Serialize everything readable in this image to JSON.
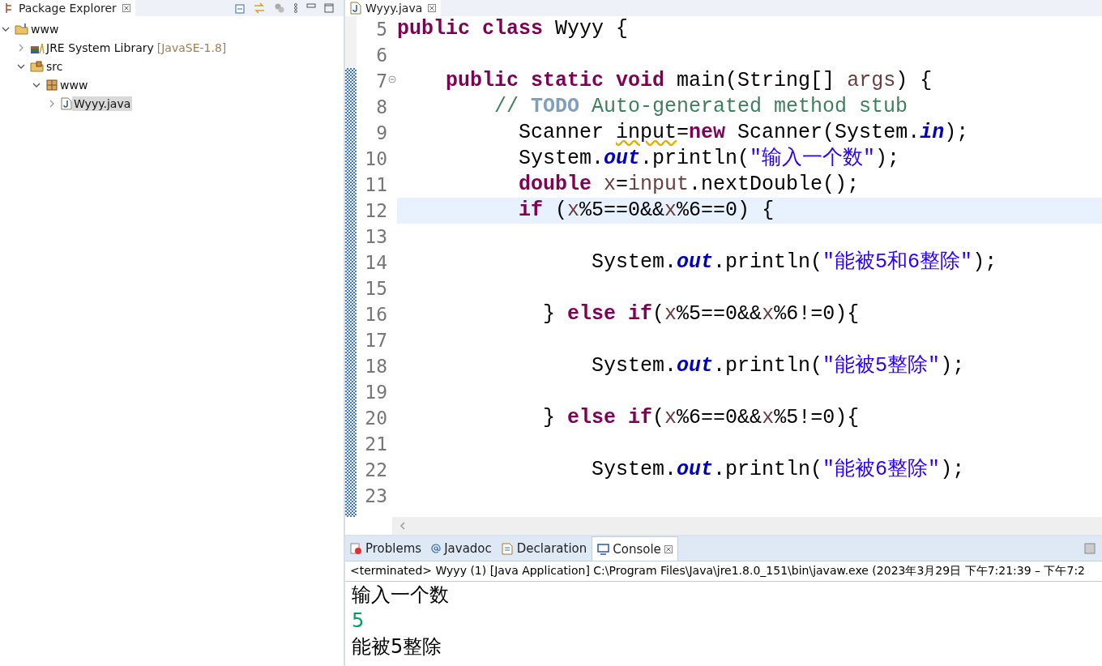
{
  "explorer": {
    "title": "Package Explorer",
    "tree": [
      {
        "label": "www",
        "kind": "project",
        "expanded": true,
        "selected": false,
        "children": [
          {
            "label": "JRE System Library",
            "decoration": "[JavaSE-1.8]",
            "kind": "library",
            "expanded": false,
            "selected": false
          },
          {
            "label": "src",
            "kind": "source-folder",
            "expanded": true,
            "selected": false,
            "children": [
              {
                "label": "www",
                "kind": "package",
                "expanded": true,
                "selected": false,
                "children": [
                  {
                    "label": "Wyyy.java",
                    "kind": "java-file",
                    "expanded": false,
                    "selected": true
                  }
                ]
              }
            ]
          }
        ]
      }
    ]
  },
  "editor": {
    "tab": "Wyyy.java",
    "lines": [
      {
        "number": "5",
        "current": false,
        "tokens": [
          {
            "kind": "keyword",
            "text": "public "
          },
          {
            "kind": "keyword",
            "text": "class"
          },
          {
            "kind": "plain",
            "text": " Wyyy {"
          }
        ]
      },
      {
        "number": "6",
        "current": false
      },
      {
        "number": "7",
        "current": false,
        "tokens": [
          {
            "kind": "keyword",
            "text": "    public "
          },
          {
            "kind": "keyword",
            "text": "static "
          },
          {
            "kind": "keyword",
            "text": "void"
          },
          {
            "kind": "plain",
            "text": " main(String[] "
          },
          {
            "kind": "local",
            "text": "args"
          },
          {
            "kind": "plain",
            "text": ") {"
          }
        ]
      },
      {
        "number": "8",
        "current": false,
        "tokens": [
          {
            "kind": "comment",
            "text": "        // "
          },
          {
            "kind": "todo",
            "text": "TODO"
          },
          {
            "kind": "comment",
            "text": " Auto-generated method stub"
          }
        ]
      },
      {
        "number": "9",
        "current": false,
        "tokens": [
          {
            "kind": "plain",
            "text": "          Scanner "
          },
          {
            "kind": "warning",
            "text": "input"
          },
          {
            "kind": "plain",
            "text": "="
          },
          {
            "kind": "keyword",
            "text": "new"
          },
          {
            "kind": "plain",
            "text": " Scanner(System."
          },
          {
            "kind": "field",
            "text": "in"
          },
          {
            "kind": "plain",
            "text": ");"
          }
        ]
      },
      {
        "number": "10",
        "current": false,
        "tokens": [
          {
            "kind": "plain",
            "text": "          System."
          },
          {
            "kind": "field",
            "text": "out"
          },
          {
            "kind": "plain",
            "text": ".println("
          },
          {
            "kind": "string",
            "text": "\"输入一个数\""
          },
          {
            "kind": "plain",
            "text": ");"
          }
        ]
      },
      {
        "number": "11",
        "current": false,
        "tokens": [
          {
            "kind": "keyword",
            "text": "          double "
          },
          {
            "kind": "local",
            "text": "x"
          },
          {
            "kind": "plain",
            "text": "="
          },
          {
            "kind": "local",
            "text": "input"
          },
          {
            "kind": "plain",
            "text": ".nextDouble();"
          }
        ]
      },
      {
        "number": "12",
        "current": true,
        "tokens": [
          {
            "kind": "keyword",
            "text": "          if"
          },
          {
            "kind": "plain",
            "text": " ("
          },
          {
            "kind": "local",
            "text": "x"
          },
          {
            "kind": "plain",
            "text": "%5==0&&"
          },
          {
            "kind": "local",
            "text": "x"
          },
          {
            "kind": "plain",
            "text": "%6==0) {"
          }
        ]
      },
      {
        "number": "13",
        "current": false
      },
      {
        "number": "14",
        "current": false,
        "tokens": [
          {
            "kind": "plain",
            "text": "                System."
          },
          {
            "kind": "field",
            "text": "out"
          },
          {
            "kind": "plain",
            "text": ".println("
          },
          {
            "kind": "string",
            "text": "\"能被5和6整除\""
          },
          {
            "kind": "plain",
            "text": ");"
          }
        ]
      },
      {
        "number": "15",
        "current": false
      },
      {
        "number": "16",
        "current": false,
        "tokens": [
          {
            "kind": "plain",
            "text": "            } "
          },
          {
            "kind": "keyword",
            "text": "else if"
          },
          {
            "kind": "plain",
            "text": "("
          },
          {
            "kind": "local",
            "text": "x"
          },
          {
            "kind": "plain",
            "text": "%5==0&&"
          },
          {
            "kind": "local",
            "text": "x"
          },
          {
            "kind": "plain",
            "text": "%6!=0){"
          }
        ]
      },
      {
        "number": "17",
        "current": false
      },
      {
        "number": "18",
        "current": false,
        "tokens": [
          {
            "kind": "plain",
            "text": "                System."
          },
          {
            "kind": "field",
            "text": "out"
          },
          {
            "kind": "plain",
            "text": ".println("
          },
          {
            "kind": "string",
            "text": "\"能被5整除\""
          },
          {
            "kind": "plain",
            "text": ");"
          }
        ]
      },
      {
        "number": "19",
        "current": false
      },
      {
        "number": "20",
        "current": false,
        "tokens": [
          {
            "kind": "plain",
            "text": "            } "
          },
          {
            "kind": "keyword",
            "text": "else if"
          },
          {
            "kind": "plain",
            "text": "("
          },
          {
            "kind": "local",
            "text": "x"
          },
          {
            "kind": "plain",
            "text": "%6==0&&"
          },
          {
            "kind": "local",
            "text": "x"
          },
          {
            "kind": "plain",
            "text": "%5!=0){"
          }
        ]
      },
      {
        "number": "21",
        "current": false
      },
      {
        "number": "22",
        "current": false,
        "tokens": [
          {
            "kind": "plain",
            "text": "                System."
          },
          {
            "kind": "field",
            "text": "out"
          },
          {
            "kind": "plain",
            "text": ".println("
          },
          {
            "kind": "string",
            "text": "\"能被6整除\""
          },
          {
            "kind": "plain",
            "text": ");"
          }
        ]
      },
      {
        "number": "23",
        "current": false
      }
    ]
  },
  "bottom": {
    "tabs": [
      {
        "label": "Problems",
        "kind": "problems",
        "selected": false
      },
      {
        "label": "Javadoc",
        "kind": "javadoc",
        "selected": false
      },
      {
        "label": "Declaration",
        "kind": "declaration",
        "selected": false
      },
      {
        "label": "Console",
        "kind": "console",
        "selected": true
      }
    ],
    "status": "<terminated> Wyyy (1) [Java Application] C:\\Program Files\\Java\\jre1.8.0_151\\bin\\javaw.exe  (2023年3月29日 下午7:21:39 – 下午7:2",
    "output": [
      {
        "kind": "output",
        "text": "输入一个数"
      },
      {
        "kind": "input",
        "text": "5"
      },
      {
        "kind": "output",
        "text": "能被5整除"
      }
    ]
  }
}
